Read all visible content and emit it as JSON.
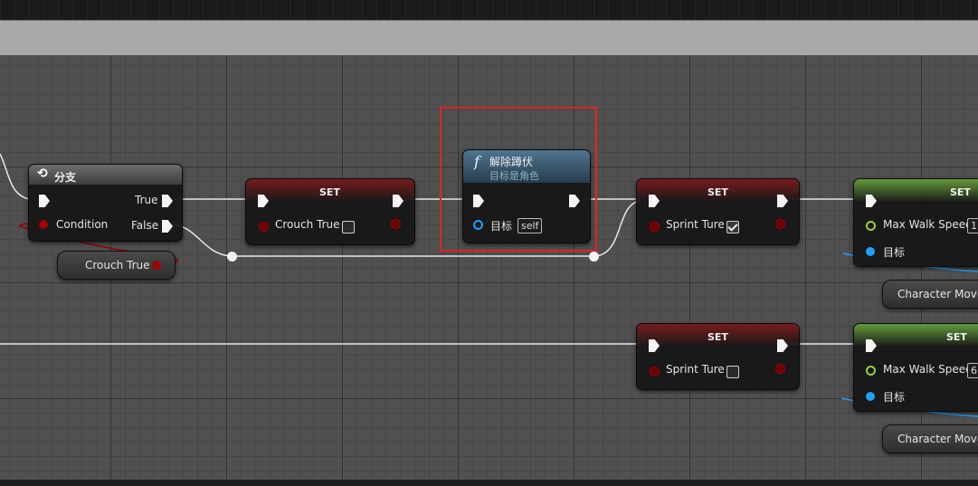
{
  "branch_node": {
    "title": "分支",
    "pin_true": "True",
    "pin_false": "False",
    "pin_condition": "Condition"
  },
  "crouch_var_node": {
    "label": "Crouch True"
  },
  "set_crouch_node": {
    "title": "SET",
    "pin_label": "Crouch True",
    "checked": false
  },
  "uncrouch_node": {
    "title": "解除蹲伏",
    "subtitle": "目标是角色",
    "target_label": "目标",
    "target_value": "self"
  },
  "set_sprint_true_node": {
    "title": "SET",
    "pin_label": "Sprint Ture",
    "checked": true
  },
  "set_sprint_false_node": {
    "title": "SET",
    "pin_label": "Sprint Ture",
    "checked": false
  },
  "set_speed_top_node": {
    "title": "SET",
    "pin_label": "Max Walk Speed",
    "value": "1",
    "target_label": "目标"
  },
  "set_speed_bottom_node": {
    "title": "SET",
    "pin_label": "Max Walk Speed",
    "value": "6",
    "target_label": "目标"
  },
  "char_movement_top": {
    "label": "Character Movem"
  },
  "char_movement_bottom": {
    "label": "Character Movem"
  },
  "colors": {
    "exec": "#f4f4f4",
    "bool_pin": "#a30000",
    "float_pin": "#9bcf3a",
    "object_pin": "#1ea0ff",
    "highlight": "#e0241f"
  },
  "icons": {
    "branch": "branch-icon",
    "function": "function-icon"
  }
}
